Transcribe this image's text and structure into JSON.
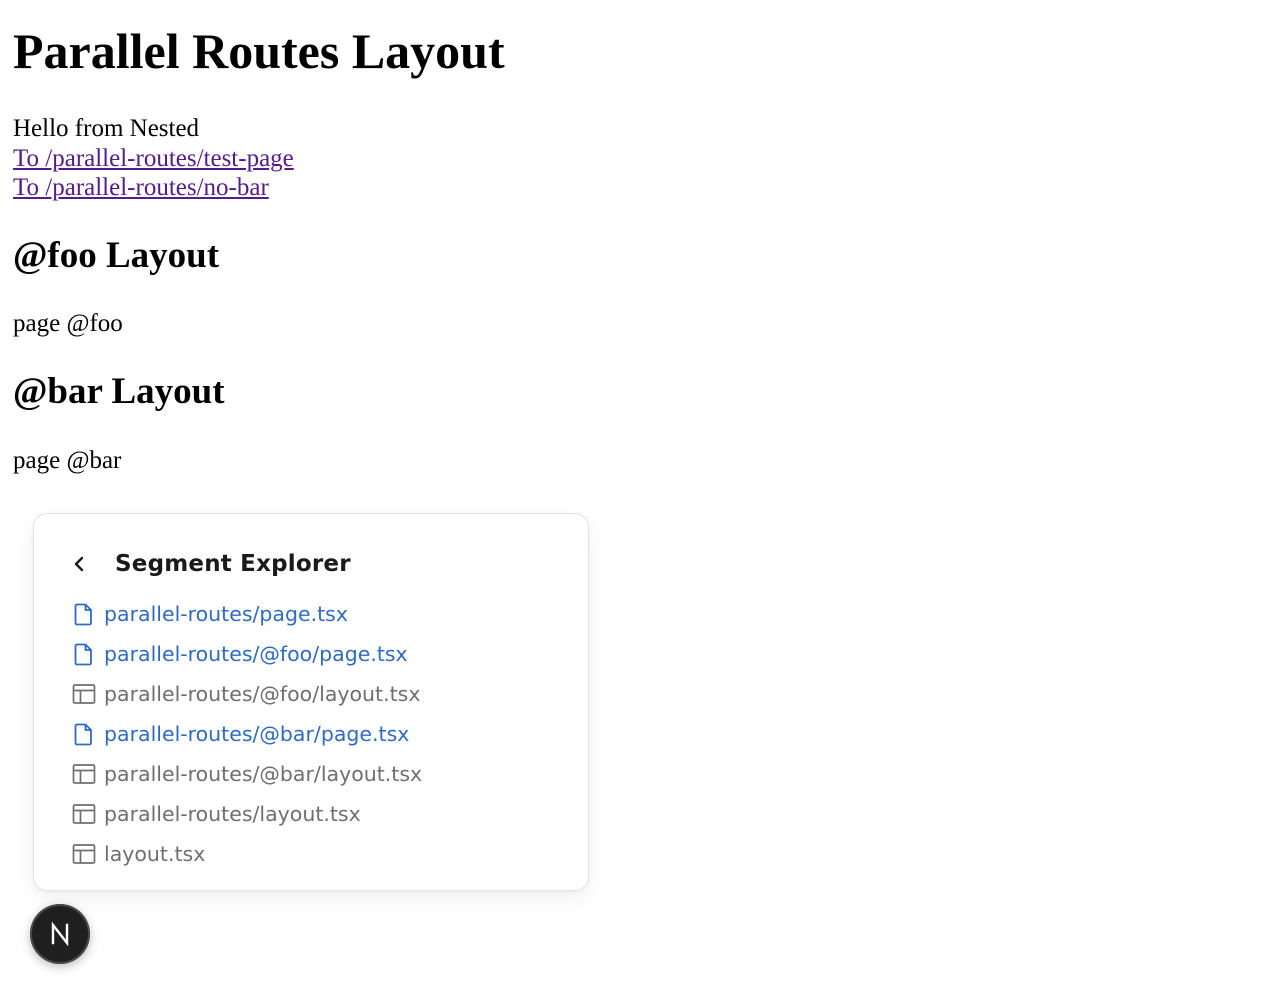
{
  "page": {
    "title": "Parallel Routes Layout",
    "greeting": "Hello from Nested",
    "links": [
      "To /parallel-routes/test-page",
      "To /parallel-routes/no-bar"
    ],
    "sections": [
      {
        "heading": "@foo Layout",
        "text": "page @foo"
      },
      {
        "heading": "@bar Layout",
        "text": "page @bar"
      }
    ]
  },
  "segment_explorer": {
    "title": "Segment Explorer",
    "back_icon": "chevron-left-icon",
    "items": [
      {
        "label": "parallel-routes/page.tsx",
        "kind": "page",
        "icon": "file-icon"
      },
      {
        "label": "parallel-routes/@foo/page.tsx",
        "kind": "page",
        "icon": "file-icon"
      },
      {
        "label": "parallel-routes/@foo/layout.tsx",
        "kind": "layout",
        "icon": "layout-icon"
      },
      {
        "label": "parallel-routes/@bar/page.tsx",
        "kind": "page",
        "icon": "file-icon"
      },
      {
        "label": "parallel-routes/@bar/layout.tsx",
        "kind": "layout",
        "icon": "layout-icon"
      },
      {
        "label": "parallel-routes/layout.tsx",
        "kind": "layout",
        "icon": "layout-icon"
      },
      {
        "label": "layout.tsx",
        "kind": "layout",
        "icon": "layout-icon"
      }
    ]
  },
  "colors": {
    "link": "#551a8b",
    "page_item": "#2f6bc2",
    "layout_item": "#6f6f6f",
    "badge_bg": "#1f1f1f"
  },
  "next_badge": {
    "icon": "nextjs-logo-icon",
    "letter": "N"
  }
}
